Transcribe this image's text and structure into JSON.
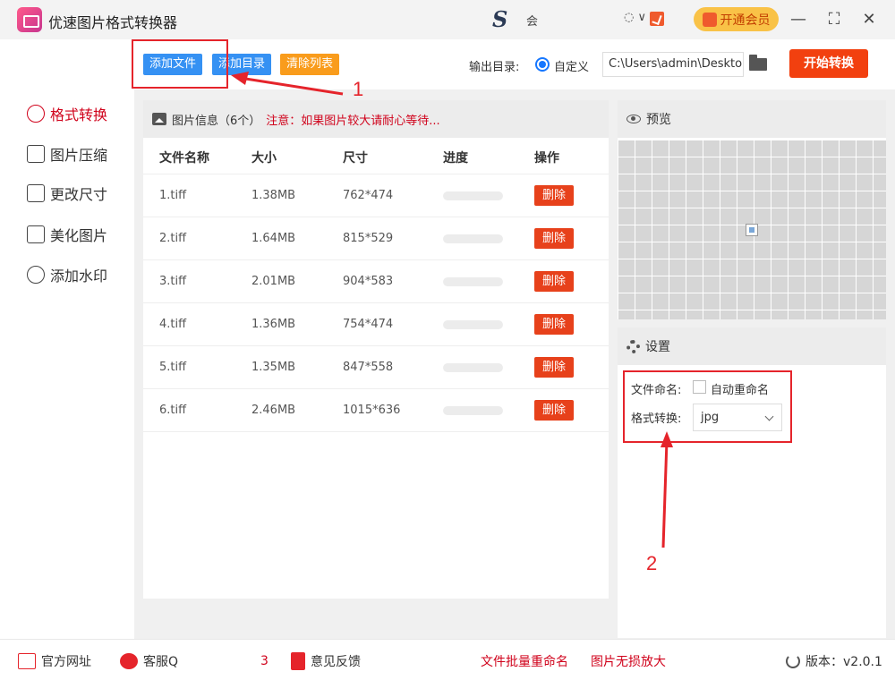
{
  "app": {
    "title": "优速图片格式转换器",
    "user_text": "会",
    "user_arrow": "◌ ∨",
    "vip_label": "开通会员",
    "minimize": "—",
    "maximize": "⛶",
    "close": "✕"
  },
  "toolbar": {
    "add_file": "添加文件",
    "add_dir": "添加目录",
    "clear_list": "清除列表",
    "output_label": "输出目录:",
    "radio_label": "自定义",
    "output_path": "C:\\Users\\admin\\Deskto",
    "start": "开始转换"
  },
  "sidebar": {
    "items": [
      {
        "label": "格式转换",
        "icon": "format-convert-icon"
      },
      {
        "label": "图片压缩",
        "icon": "compress-icon"
      },
      {
        "label": "更改尺寸",
        "icon": "resize-icon"
      },
      {
        "label": "美化图片",
        "icon": "beautify-icon"
      },
      {
        "label": "添加水印",
        "icon": "watermark-icon"
      }
    ]
  },
  "list": {
    "header": "图片信息（6个）",
    "notice": "注意：如果图片较大请耐心等待...",
    "columns": [
      "文件名称",
      "大小",
      "尺寸",
      "进度",
      "操作"
    ],
    "delete_label": "删除",
    "rows": [
      {
        "name": "1.tiff",
        "size": "1.38MB",
        "dims": "762*474",
        "progress": 0
      },
      {
        "name": "2.tiff",
        "size": "1.64MB",
        "dims": "815*529",
        "progress": 0
      },
      {
        "name": "3.tiff",
        "size": "2.01MB",
        "dims": "904*583",
        "progress": 0
      },
      {
        "name": "4.tiff",
        "size": "1.36MB",
        "dims": "754*474",
        "progress": 0
      },
      {
        "name": "5.tiff",
        "size": "1.35MB",
        "dims": "847*558",
        "progress": 0
      },
      {
        "name": "6.tiff",
        "size": "2.46MB",
        "dims": "1015*636",
        "progress": 0
      }
    ]
  },
  "preview": {
    "title": "预览"
  },
  "settings": {
    "title": "设置",
    "naming_label": "文件命名:",
    "auto_rename": "自动重命名",
    "format_label": "格式转换:",
    "format_value": "jpg"
  },
  "annotations": {
    "one": "1",
    "two": "2"
  },
  "footer": {
    "website": "官方网址",
    "support": "客服Q",
    "support_tail": "3",
    "feedback": "意见反馈",
    "batch_rename": "文件批量重命名",
    "lossless": "图片无损放大",
    "version": "版本：v2.0.1"
  },
  "colors": {
    "accent_red": "#e5242b",
    "blue_button": "#3591f3",
    "orange_button": "#f99c1c",
    "start_button": "#f2400f"
  }
}
